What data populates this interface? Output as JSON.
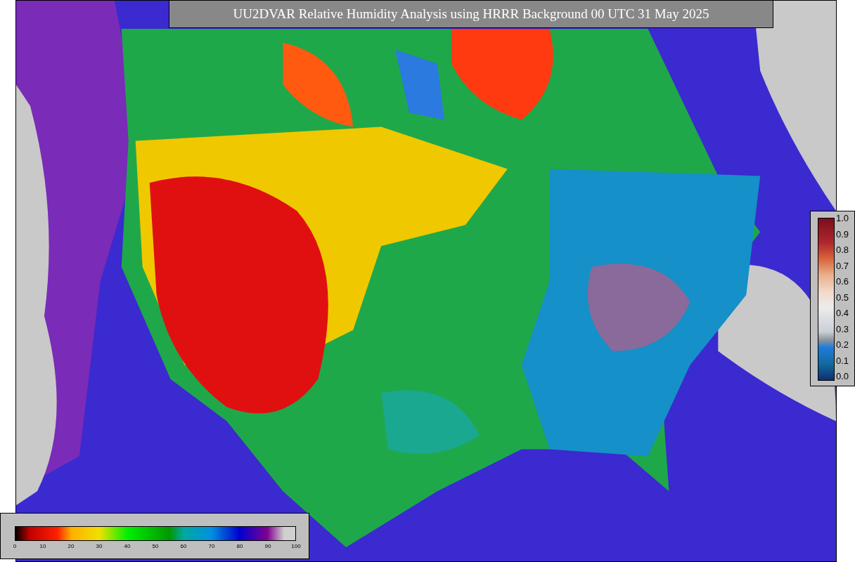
{
  "title": "UU2DVAR Relative Humidity Analysis using HRRR Background 00 UTC 31 May 2025",
  "weight_colorbar": {
    "ticks": [
      "1.0",
      "0.9",
      "0.8",
      "0.7",
      "0.6",
      "0.5",
      "0.4",
      "0.3",
      "0.2",
      "0.1",
      "0.0"
    ]
  },
  "humidity_colorbar": {
    "ticks": [
      "0",
      "10",
      "20",
      "30",
      "40",
      "50",
      "60",
      "70",
      "80",
      "90",
      "100"
    ]
  }
}
